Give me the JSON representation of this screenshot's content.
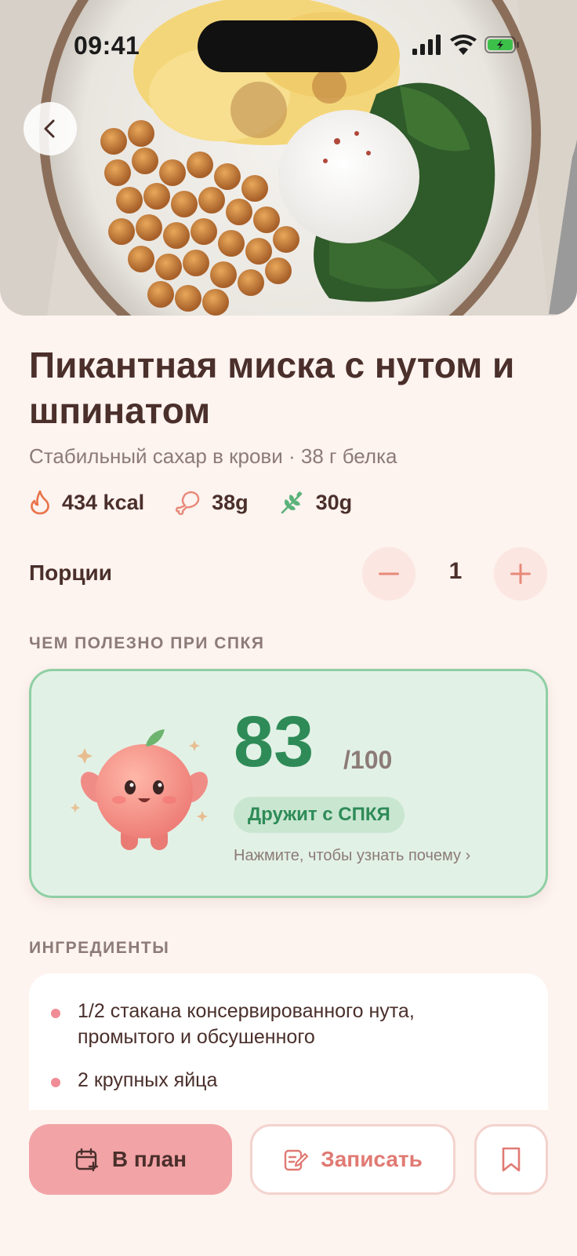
{
  "status_bar": {
    "time": "09:41"
  },
  "recipe": {
    "title": "Пикантная миска с нутом и шпинатом",
    "subtitle": "Стабильный сахар в крови · 38 г белка",
    "macros": {
      "calories": "434 kcal",
      "protein": "38g",
      "fiber": "30g"
    }
  },
  "portions": {
    "label": "Порции",
    "value": "1"
  },
  "pcos_section": {
    "label": "ЧЕМ ПОЛЕЗНО ПРИ СПКЯ",
    "score": "83",
    "score_max": "/100",
    "badge": "Дружит с СПКЯ",
    "hint": "Нажмите, чтобы узнать почему ›"
  },
  "ingredients_section": {
    "label": "ИНГРЕДИЕНТЫ",
    "items": [
      "1/2 стакана консервированного нута, промытого и обсушенного",
      "2 крупных яйца"
    ]
  },
  "actions": {
    "plan_label": "В план",
    "log_label": "Записать"
  },
  "colors": {
    "background": "#FDF3EF",
    "accent": "#F2A3A6",
    "score_green": "#2E8B57",
    "card_green": "#E2F1E6"
  }
}
